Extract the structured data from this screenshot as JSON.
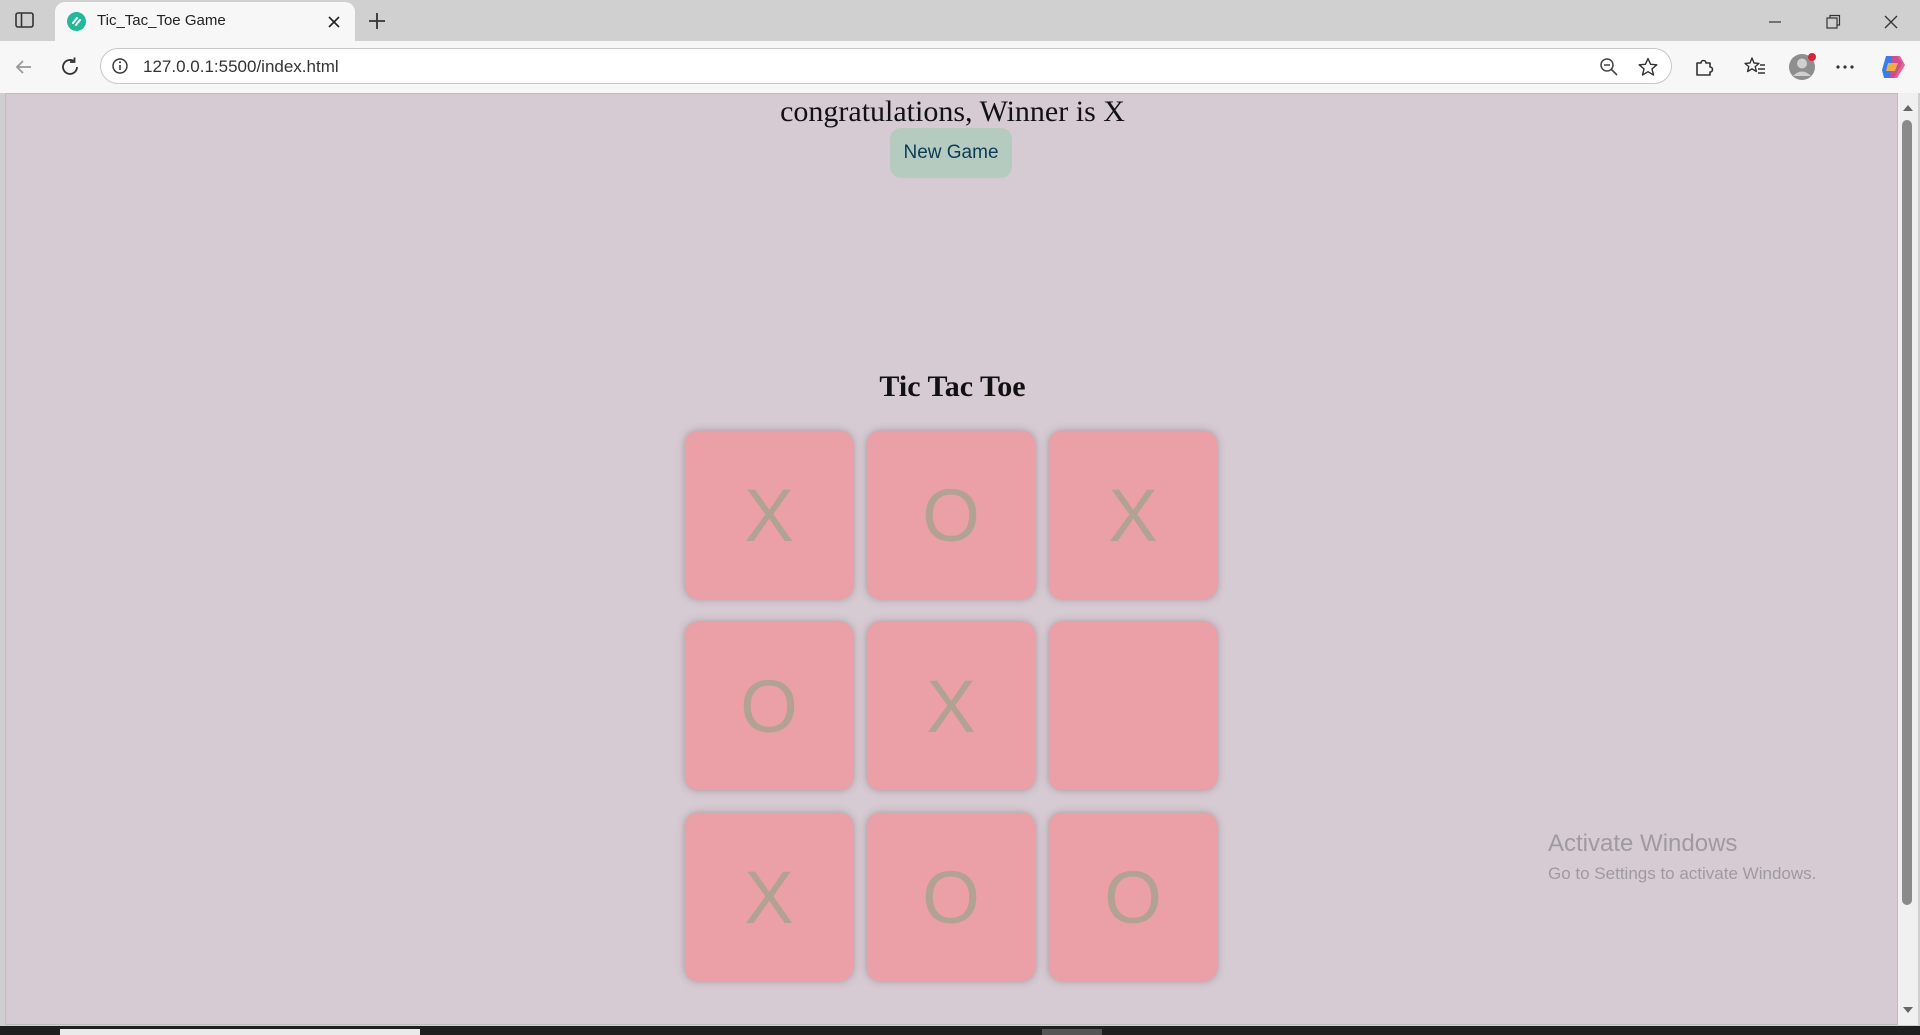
{
  "browser": {
    "tab_title": "Tic_Tac_Toe Game",
    "url": "127.0.0.1:5500/index.html"
  },
  "page": {
    "message": "congratulations, Winner is X",
    "new_game_label": "New Game",
    "title": "Tic Tac Toe",
    "board": [
      [
        "X",
        "O",
        "X"
      ],
      [
        "O",
        "X",
        ""
      ],
      [
        "X",
        "O",
        "O"
      ]
    ],
    "colors": {
      "page_background": "#d6cbd3",
      "cell_background": "#eaa0a6",
      "cell_text": "#b1a294",
      "button_background": "#b6cbc0",
      "button_text": "#0d3b56"
    }
  },
  "os": {
    "watermark_title": "Activate Windows",
    "watermark_subtitle": "Go to Settings to activate Windows."
  }
}
